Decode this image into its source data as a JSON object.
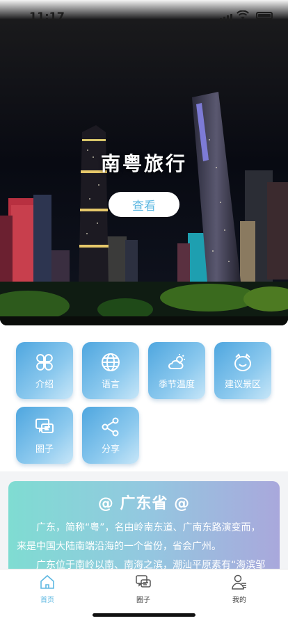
{
  "status": {
    "time": "11:17"
  },
  "hero": {
    "title": "南粤旅行",
    "button": "查看"
  },
  "tiles": [
    {
      "label": "介绍",
      "icon": "clover-icon"
    },
    {
      "label": "语言",
      "icon": "globe-icon"
    },
    {
      "label": "季节温度",
      "icon": "weather-icon"
    },
    {
      "label": "建议景区",
      "icon": "smile-icon"
    },
    {
      "label": "圈子",
      "icon": "chat-icon"
    },
    {
      "label": "分享",
      "icon": "share-icon"
    }
  ],
  "info": {
    "title": "@ 广东省 @",
    "p1": "广东，简称“粤”，名由岭南东道、广南东路演变而，来是中国大陆南端沿海的一个省份，省会广州。",
    "p2": "广东位于南岭以南、南海之滨，潮汕平原素有“海滨邹"
  },
  "tabbar": {
    "items": [
      {
        "label": "首页",
        "active": true
      },
      {
        "label": "圈子",
        "active": false
      },
      {
        "label": "我的",
        "active": false
      }
    ]
  },
  "colors": {
    "accent": "#5eb8e2",
    "tab_inactive": "#444444"
  }
}
